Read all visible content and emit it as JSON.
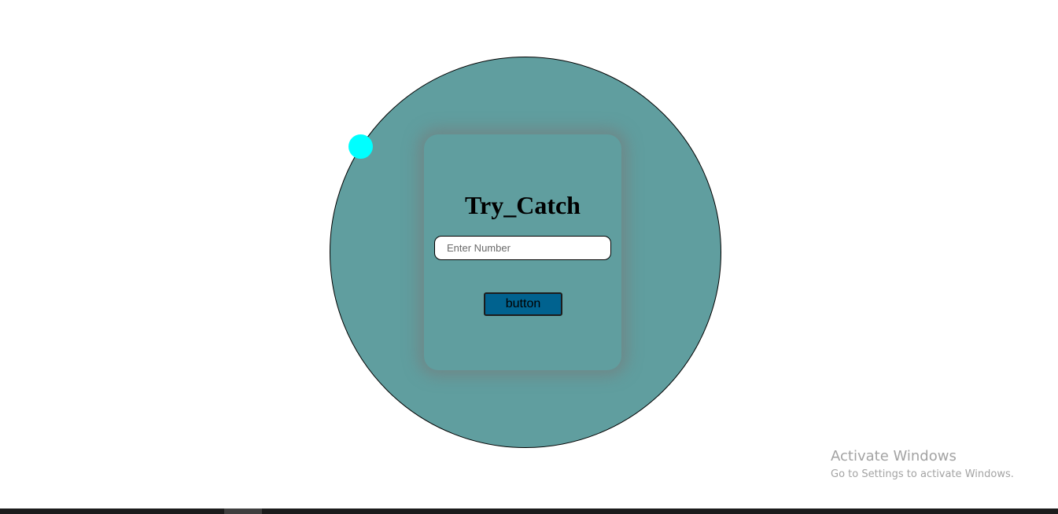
{
  "card": {
    "title": "Try_Catch",
    "input_placeholder": "Enter Number",
    "input_value": "",
    "button_label": "button"
  },
  "watermark": {
    "title": "Activate Windows",
    "subtitle": "Go to Settings to activate Windows."
  },
  "colors": {
    "circle": "#609e9f",
    "dot": "#00ffff",
    "button": "#00628f",
    "taskbar": "#1c1c1c"
  }
}
